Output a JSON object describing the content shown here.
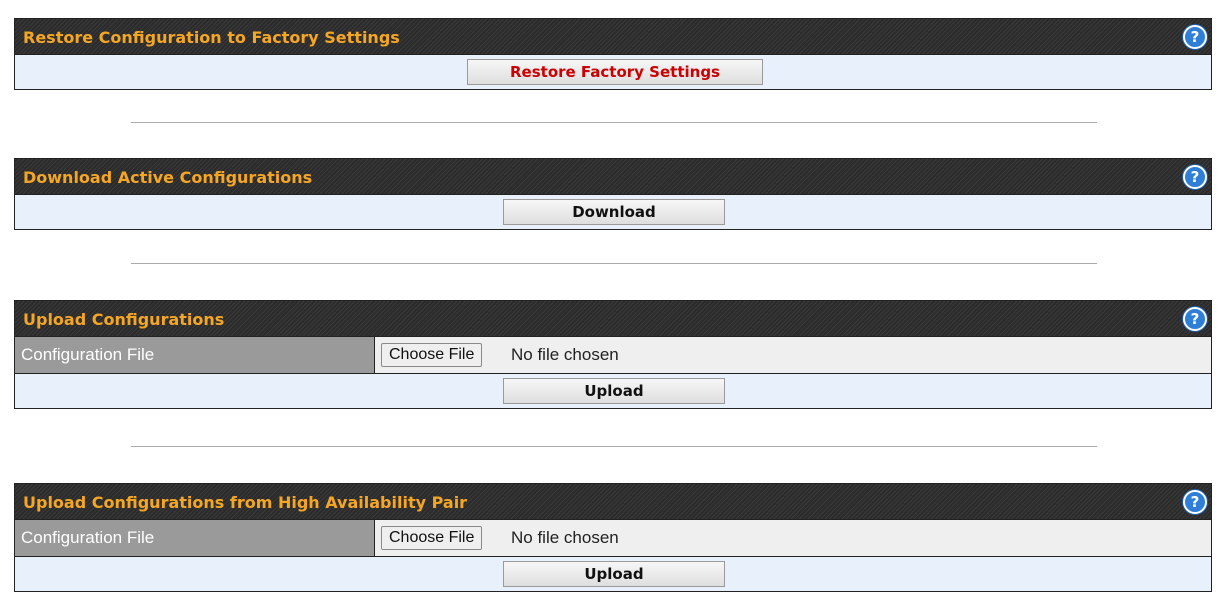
{
  "sections": {
    "restore": {
      "title": "Restore Configuration to Factory Settings",
      "button": "Restore Factory Settings"
    },
    "download": {
      "title": "Download Active Configurations",
      "button": "Download"
    },
    "upload": {
      "title": "Upload Configurations",
      "field_label": "Configuration File",
      "choose_button": "Choose File",
      "file_status": "No file chosen",
      "button": "Upload"
    },
    "upload_ha": {
      "title": "Upload Configurations from High Availability Pair",
      "field_label": "Configuration File",
      "choose_button": "Choose File",
      "file_status": "No file chosen",
      "button": "Upload"
    }
  },
  "help_icon_glyph": "?",
  "colors": {
    "header_bg": "#2b2b2b",
    "header_text": "#f5a623",
    "row_bg": "#e8f0fb",
    "label_bg": "#9a9a9a",
    "danger_text": "#cc0000",
    "help_icon": "#2f7fd8"
  }
}
